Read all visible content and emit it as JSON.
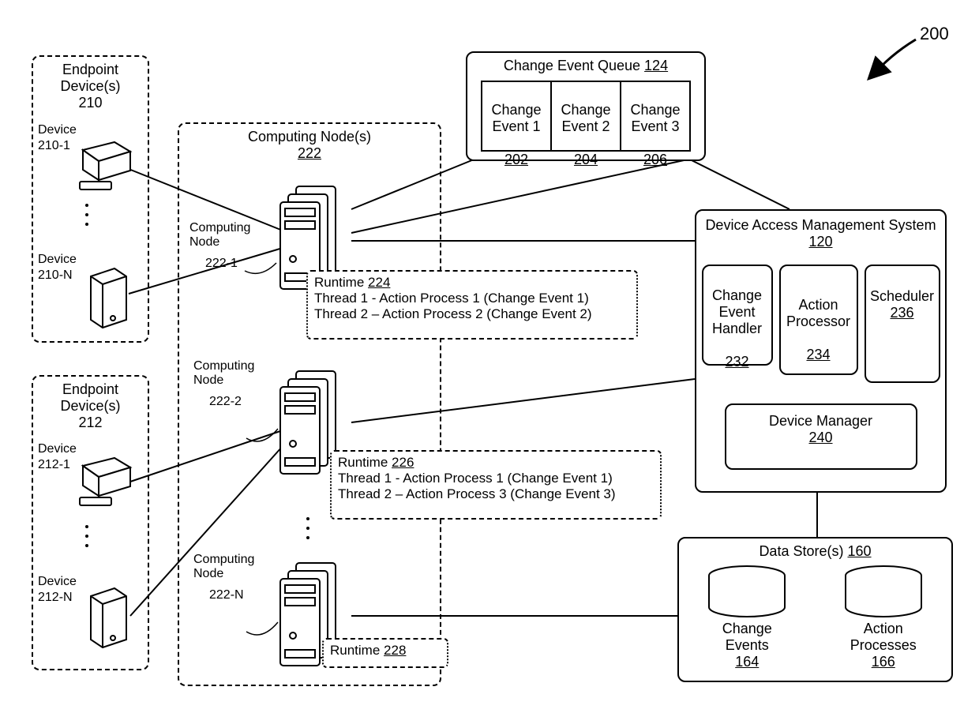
{
  "figure_ref": "200",
  "endpoint_group_1": {
    "title": "Endpoint\nDevice(s)",
    "ref": "210",
    "devices": [
      {
        "label": "Device",
        "ref": "210-1",
        "kind": "pc"
      },
      {
        "label": "Device",
        "ref": "210-N",
        "kind": "phone"
      }
    ]
  },
  "endpoint_group_2": {
    "title": "Endpoint\nDevice(s)",
    "ref": "212",
    "devices": [
      {
        "label": "Device",
        "ref": "212-1",
        "kind": "pc"
      },
      {
        "label": "Device",
        "ref": "212-N",
        "kind": "phone"
      }
    ]
  },
  "computing_nodes": {
    "title": "Computing Node(s)",
    "ref": "222",
    "nodes": [
      {
        "label": "Computing\nNode",
        "ref": "222-1"
      },
      {
        "label": "Computing\nNode",
        "ref": "222-2"
      },
      {
        "label": "Computing\nNode",
        "ref": "222-N"
      }
    ]
  },
  "runtimes": [
    {
      "title": "Runtime",
      "ref": "224",
      "threads": [
        "Thread 1 - Action Process 1 (Change Event 1)",
        "Thread 2 – Action Process 2 (Change Event 2)"
      ]
    },
    {
      "title": "Runtime",
      "ref": "226",
      "threads": [
        "Thread 1 - Action Process 1 (Change Event 1)",
        "Thread 2 – Action Process 3 (Change Event 3)"
      ]
    },
    {
      "title": "Runtime",
      "ref": "228",
      "threads": []
    }
  ],
  "queue": {
    "title": "Change Event Queue",
    "ref": "124",
    "events": [
      {
        "label": "Change\nEvent 1",
        "ref": "202"
      },
      {
        "label": "Change\nEvent 2",
        "ref": "204"
      },
      {
        "label": "Change\nEvent 3",
        "ref": "206"
      }
    ]
  },
  "dams": {
    "title": "Device Access Management System",
    "ref": "120",
    "components": [
      {
        "label": "Change\nEvent\nHandler",
        "ref": "232"
      },
      {
        "label": "Action\nProcessor",
        "ref": "234"
      },
      {
        "label": "Scheduler",
        "ref": "236"
      }
    ],
    "manager": {
      "label": "Device Manager",
      "ref": "240"
    }
  },
  "datastore": {
    "title": "Data Store(s)",
    "ref": "160",
    "stores": [
      {
        "label": "Change\nEvents",
        "ref": "164"
      },
      {
        "label": "Action\nProcesses",
        "ref": "166"
      }
    ]
  }
}
